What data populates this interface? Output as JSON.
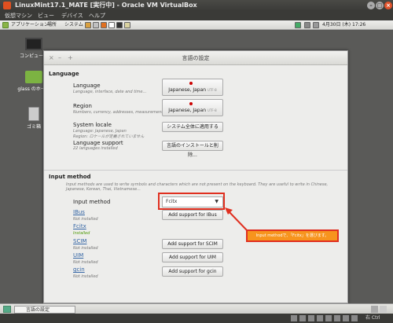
{
  "vbox": {
    "title": "LinuxMint17.1_MATE [実行中] - Oracle VM VirtualBox",
    "menu": [
      "仮想マシン",
      "ビュー",
      "デバイス",
      "ヘルプ"
    ],
    "host_key": "右 Ctrl"
  },
  "panel": {
    "menus": [
      "アプリケーション",
      "場所",
      "システム"
    ],
    "clock": "4月30日 (木) 17:26"
  },
  "desktop": {
    "icons": [
      "コンピュータ",
      "glass のホーム",
      "ゴミ箱"
    ]
  },
  "window": {
    "title": "言語の設定",
    "language_section": "Language",
    "rows": [
      {
        "label": "Language",
        "sub": "Language, interface, date and time...",
        "button": "Japanese, Japan",
        "utf": "UTF-8"
      },
      {
        "label": "Region",
        "sub": "Numbers, currency, addresses, measurement...",
        "button": "Japanese, Japan",
        "utf": "UTF-8"
      },
      {
        "label": "System locale",
        "sub": "Language: Japanese, Japan",
        "sub2": "Region: ロケールが定義されていません",
        "button": "システム全体に適用する"
      },
      {
        "label": "Language support",
        "sub": "22 languages installed",
        "button": "言語のインストールと削除..."
      }
    ],
    "im_section": "Input method",
    "im_desc": "Input methods are used to write symbols and characters which are not present on the keyboard. They are useful to write in Chinese, Japanese, Korean, Thai, Vietnamese...",
    "im_label": "Input method",
    "im_value": "Fcitx",
    "methods": [
      {
        "name": "IBus",
        "status": "Not installed",
        "button": "Add support for IBus"
      },
      {
        "name": "Fcitx",
        "status": "Installed",
        "button": ""
      },
      {
        "name": "SCIM",
        "status": "Not installed",
        "button": "Add support for SCIM"
      },
      {
        "name": "UIM",
        "status": "Not installed",
        "button": "Add support for UIM"
      },
      {
        "name": "gcin",
        "status": "Not installed",
        "button": "Add support for gcin"
      }
    ]
  },
  "callout": "Input methodで、「Fcitx」を選びます。",
  "taskbar": {
    "item": "言語の設定"
  },
  "colors": {
    "annotation_red": "#e03020",
    "callout_orange": "#f7941d"
  }
}
